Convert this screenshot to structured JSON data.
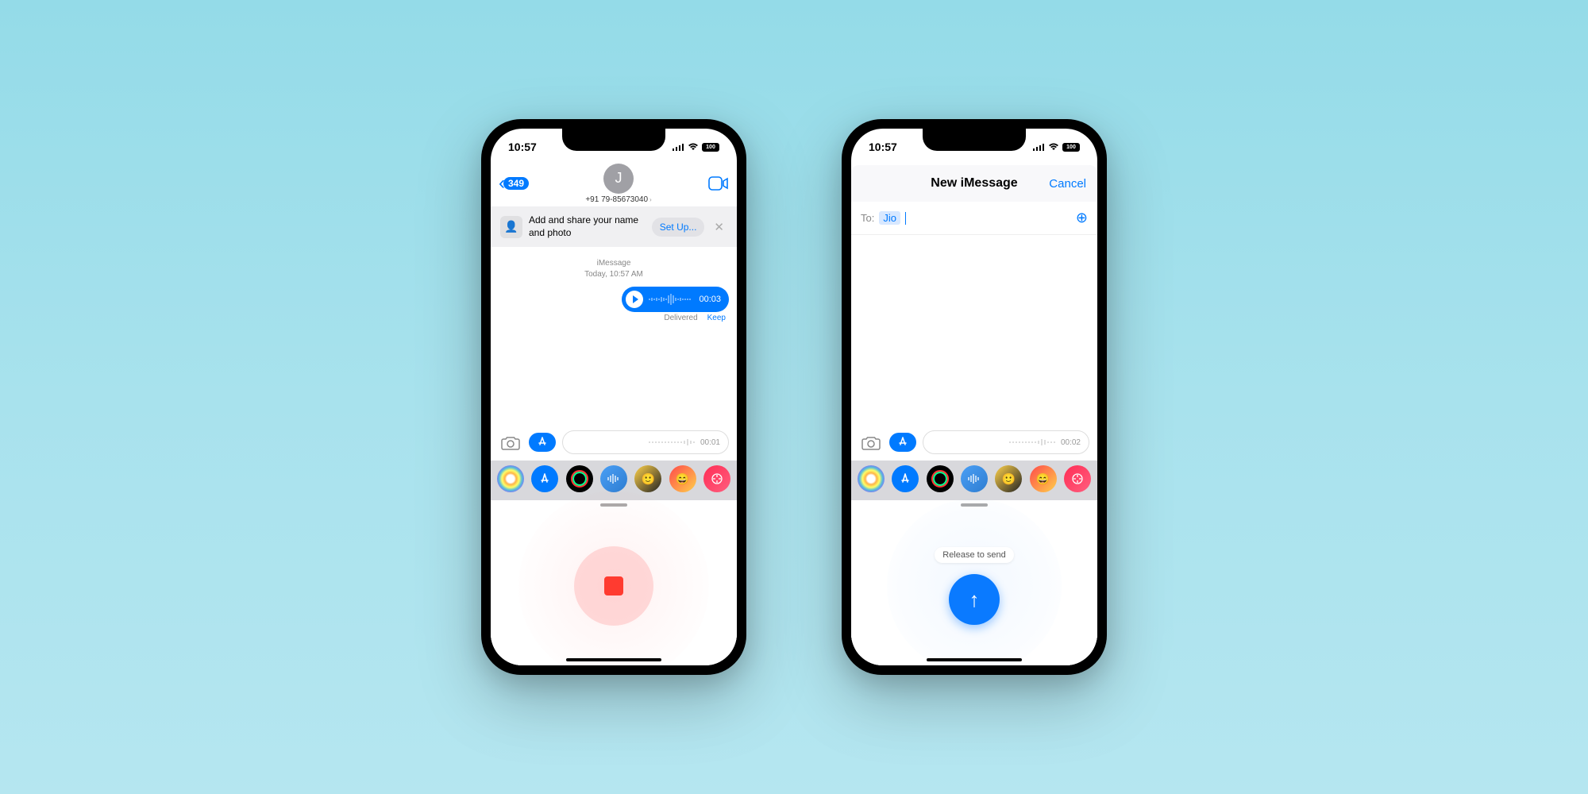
{
  "status": {
    "time": "10:57",
    "battery": "100"
  },
  "left": {
    "back_badge": "349",
    "avatar_letter": "J",
    "contact": "+91 79-85673040",
    "banner_text": "Add and share your name and photo",
    "setup": "Set Up...",
    "thread_label": "iMessage",
    "thread_time": "Today, 10:57 AM",
    "audio_duration": "00:03",
    "delivered": "Delivered",
    "keep": "Keep",
    "compose_timer": "00:01"
  },
  "right": {
    "title": "New iMessage",
    "cancel": "Cancel",
    "to_label": "To:",
    "recipient": "Jio",
    "compose_timer": "00:02",
    "release_hint": "Release to send"
  }
}
